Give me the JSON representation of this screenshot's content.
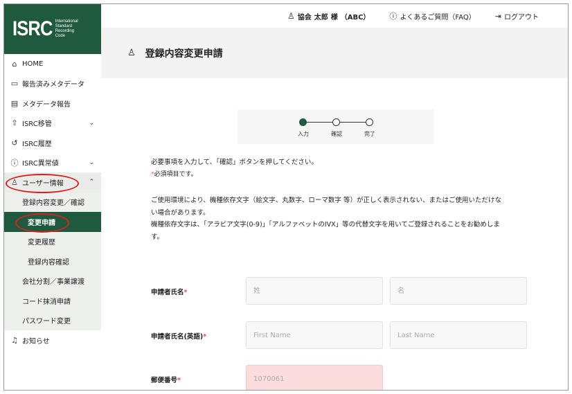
{
  "logo": {
    "mark": "ISRC",
    "sub_lines": [
      "International",
      "Standard",
      "Recording",
      "Code"
    ]
  },
  "header": {
    "user_prefix": "協会",
    "user_name": "太郎",
    "user_suffix": "様",
    "user_org": "（ABC）",
    "faq": "よくあるご質問（FAQ）",
    "logout": "ログアウト"
  },
  "sidebar": {
    "items": [
      {
        "label": "HOME",
        "icon": "home-icon"
      },
      {
        "label": "報告済みメタデータ",
        "icon": "clipboard-icon"
      },
      {
        "label": "メタデータ報告",
        "icon": "document-icon"
      },
      {
        "label": "ISRC移管",
        "icon": "export-icon"
      },
      {
        "label": "ISRC履歴",
        "icon": "history-icon"
      },
      {
        "label": "ISRC異常値",
        "icon": "alert-icon"
      },
      {
        "label": "ユーザー情報",
        "icon": "user-icon"
      },
      {
        "label": "お知らせ",
        "icon": "bell-icon"
      }
    ],
    "sub_items": [
      {
        "label": "登録内容変更／確認"
      },
      {
        "label": "変更申請"
      },
      {
        "label": "変更履歴"
      },
      {
        "label": "登録内容確認"
      },
      {
        "label": "会社分割／事業譲渡"
      },
      {
        "label": "コード抹消申請"
      },
      {
        "label": "パスワード変更"
      }
    ]
  },
  "page": {
    "title": "登録内容変更申請"
  },
  "stepper": {
    "steps": [
      "入力",
      "確認",
      "完了"
    ],
    "current": 0
  },
  "instructions": {
    "line1": "必要事項を入力して、「確認」ボタンを押してください。",
    "line2": "必須項目です。",
    "required_mark": "*",
    "note1": "ご使用環境により、機種依存文字（絵文字、丸数字、ローマ数字 等）が正しく表示されない、またはご使用いただけな",
    "note2": "い場合があります。",
    "note3": "機種依存文字は、「アラビア文字(0-9)」「アルファベットのIVX」等の代替文字を用いてご登録されることをお勧めしま",
    "note4": "す。"
  },
  "form": {
    "name_label": "申請者氏名",
    "name_last_placeholder": "姓",
    "name_first_placeholder": "名",
    "name_en_label": "申請者氏名(英語)",
    "name_en_first_placeholder": "First Name",
    "name_en_last_placeholder": "Last Name",
    "postal_label": "郵便番号",
    "postal_placeholder": "1070061",
    "required_mark": "*"
  },
  "colors": {
    "brand": "#1f5a3e",
    "required": "#d9534f",
    "highlight": "#d92020",
    "error_bg": "#fcdcdc"
  }
}
